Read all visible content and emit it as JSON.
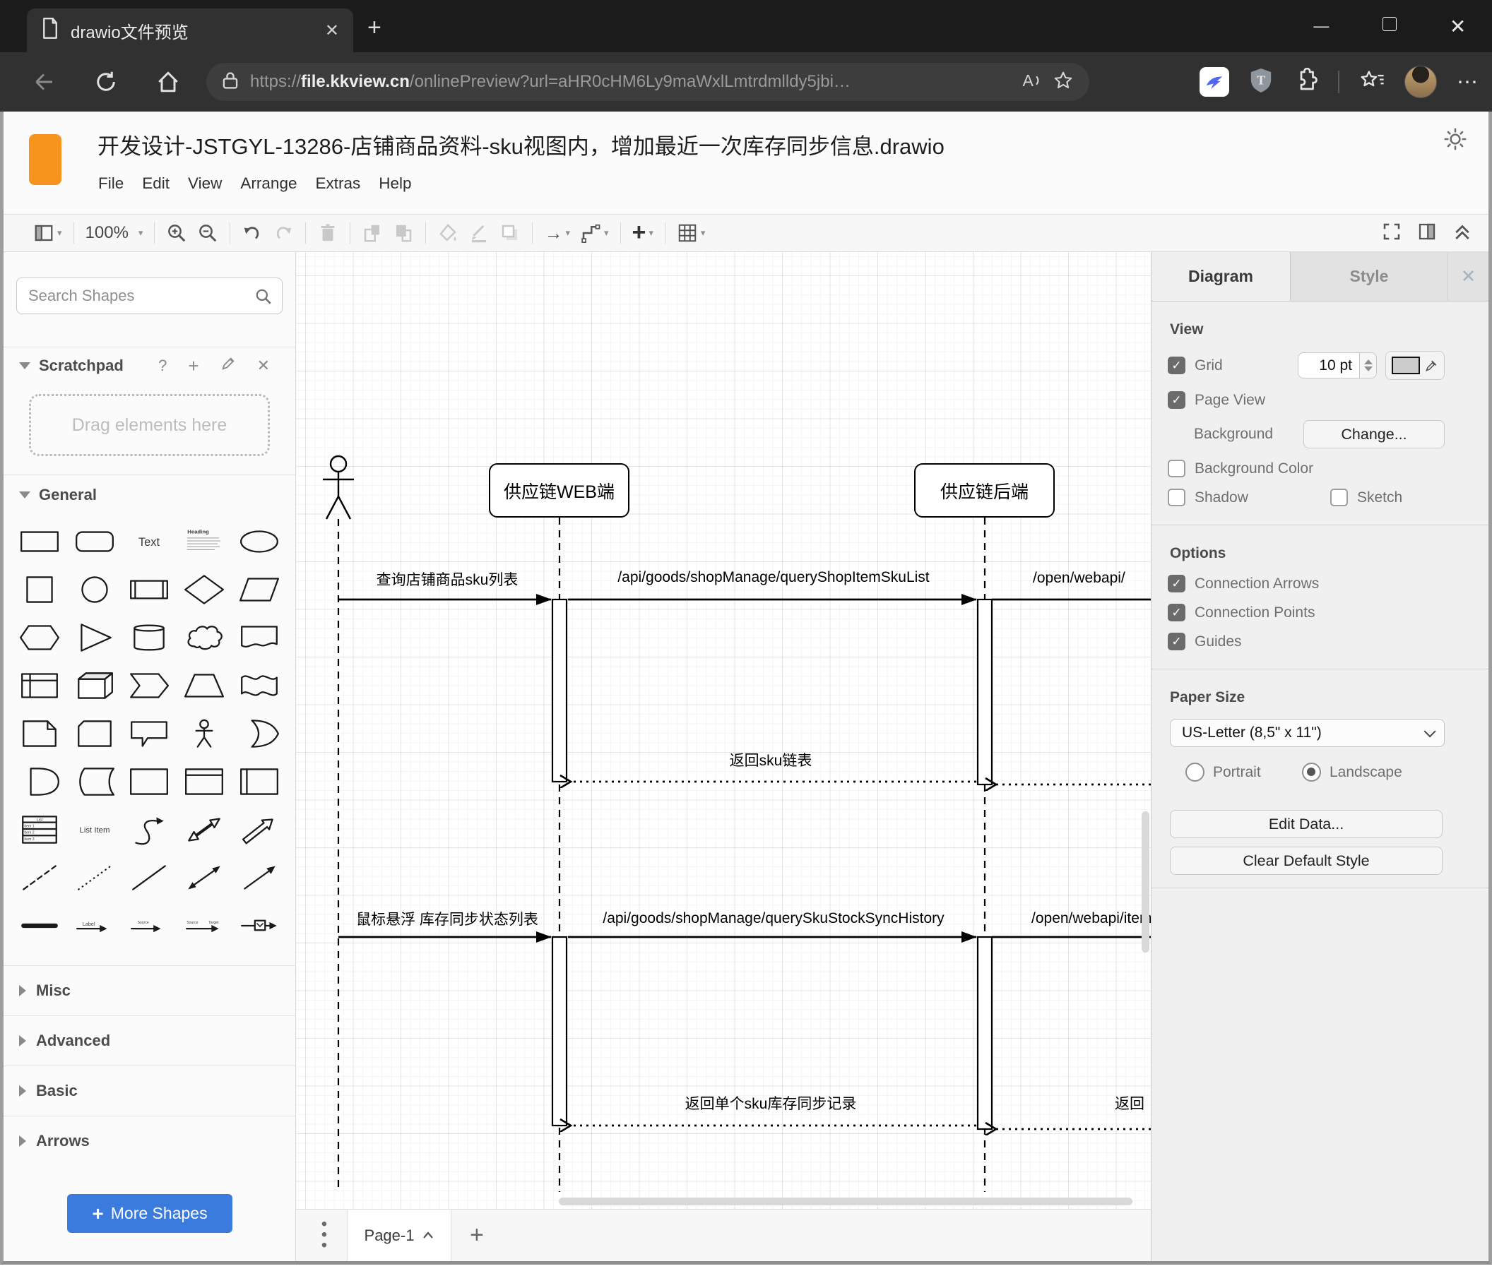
{
  "browser": {
    "tab_title": "drawio文件预览",
    "url_scheme": "https://",
    "url_host": "file.kkview.cn",
    "url_path": "/onlinePreview?url=aHR0cHM6Ly9maWxlLmtrdmlldy5jbi…"
  },
  "app": {
    "title": "开发设计-JSTGYL-13286-店铺商品资料-sku视图内，增加最近一次库存同步信息.drawio",
    "menu": [
      "File",
      "Edit",
      "View",
      "Arrange",
      "Extras",
      "Help"
    ],
    "zoom_level": "100%"
  },
  "sidebar": {
    "search_placeholder": "Search Shapes",
    "scratchpad_label": "Scratchpad",
    "drop_hint": "Drag elements here",
    "section_general": "General",
    "sections_collapsed": [
      "Misc",
      "Advanced",
      "Basic",
      "Arrows"
    ],
    "more_shapes_label": "More Shapes",
    "shape_text_label": "Text",
    "shape_heading_label": "Heading",
    "shape_list_title": "List",
    "shape_list_items": [
      "Item 1",
      "Item 2",
      "Item 3"
    ],
    "shape_list_item_label": "List Item",
    "shape_label_text": "Label",
    "shape_source_label": "Source",
    "shape_target_label": "Target",
    "shapes": [
      "rectangle",
      "rounded-rectangle",
      "text",
      "textbox",
      "ellipse",
      "square",
      "circle",
      "process",
      "diamond",
      "parallelogram",
      "hexagon",
      "triangle",
      "cylinder",
      "cloud",
      "document",
      "internal-storage",
      "cube",
      "step",
      "trapezoid",
      "tape",
      "note",
      "card",
      "callout",
      "actor",
      "or",
      "and",
      "data-storage",
      "container",
      "container-title",
      "container-side",
      "list",
      "list-item",
      "curve",
      "bidirectional-arrow",
      "arrow",
      "dashed-line",
      "dotted-line",
      "line",
      "bidirectional-connector",
      "directional-connector",
      "link",
      "arrow-label",
      "arrow-source",
      "arrow-source-target",
      "arrow-box"
    ]
  },
  "canvas": {
    "lifelines": [
      "供应链WEB端",
      "供应链后端"
    ],
    "messages": {
      "m1": "查询店铺商品sku列表",
      "m2": "/api/goods/shopManage/queryShopItemSkuList",
      "m3": "/open/webapi/",
      "r1": "返回sku链表",
      "m4": "鼠标悬浮 库存同步状态列表",
      "m5": "/api/goods/shopManage/querySkuStockSyncHistory",
      "m6": "/open/webapi/item",
      "r2": "返回单个sku库存同步记录",
      "r3": "返回"
    },
    "page_tab": "Page-1"
  },
  "panel": {
    "tab_diagram": "Diagram",
    "tab_style": "Style",
    "view_heading": "View",
    "grid_label": "Grid",
    "grid_size": "10 pt",
    "page_view_label": "Page View",
    "background_label": "Background",
    "change_button": "Change...",
    "background_color_label": "Background Color",
    "shadow_label": "Shadow",
    "sketch_label": "Sketch",
    "options_heading": "Options",
    "connection_arrows_label": "Connection Arrows",
    "connection_points_label": "Connection Points",
    "guides_label": "Guides",
    "paper_size_heading": "Paper Size",
    "paper_size_value": "US-Letter (8,5\" x 11\")",
    "portrait_label": "Portrait",
    "landscape_label": "Landscape",
    "edit_data_button": "Edit Data...",
    "clear_default_style_button": "Clear Default Style"
  },
  "colors": {
    "accent_blue": "#3a7bdd",
    "logo_orange": "#f7941e",
    "chrome_dark": "#1b1b1b"
  }
}
